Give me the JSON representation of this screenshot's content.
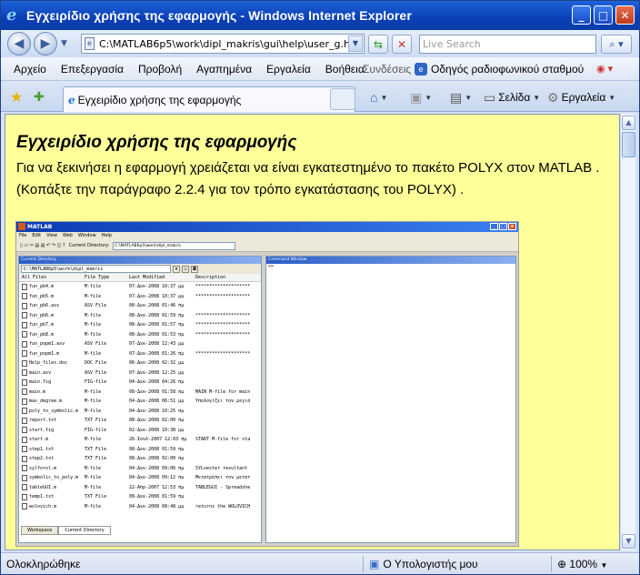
{
  "window": {
    "title": "Εγχειρίδιο χρήσης της εφαρμογής - Windows Internet Explorer",
    "minimize": "_",
    "maximize": "□",
    "close": "✕"
  },
  "address_bar": {
    "url": "C:\\MATLAB6p5\\work\\dipl_makris\\gui\\help\\user_g.htm",
    "search_placeholder": "Live Search"
  },
  "menu": {
    "items": [
      "Αρχείο",
      "Επεξεργασία",
      "Προβολή",
      "Αγαπημένα",
      "Εργαλεία",
      "Βοήθεια"
    ],
    "links_label": "Συνδέσεις",
    "radio_label": "Οδηγός ραδιοφωνικού σταθμού"
  },
  "tab": {
    "title": "Εγχειρίδιο χρήσης της εφαρμογής"
  },
  "toolbar": {
    "page_label": "Σελίδα",
    "tools_label": "Εργαλεία"
  },
  "content": {
    "heading": "Εγχειρίδιο χρήσης της εφαρμογής",
    "para1": "Για να ξεκινήσει η εφαρμογή χρειάζεται να είναι εγκατεστημένο το πακέτο POLYX στον MATLAB .",
    "para2": "(Κοπάξτε την παράγραφο 2.2.4 για τον τρόπο εγκατάστασης του POLYX) ."
  },
  "matlab_screenshot": {
    "title": "MATLAB",
    "menu": [
      "File",
      "Edit",
      "View",
      "Web",
      "Window",
      "Help"
    ],
    "current_dir_label": "Current Directory:",
    "current_dir_value": "C:\\MATLAB6p5\\work\\dipl_makris",
    "left_pane_title": "Current Directory",
    "right_pane_title": "Command Window",
    "path_value": "C:\\MATLAB6p5\\work\\dipl_makris",
    "columns": [
      "All Files",
      "File Type",
      "Last Modified",
      "Description"
    ],
    "files": [
      [
        "fun_pb4.m",
        "M-file",
        "07-Δεκ-2008 10:37 μμ",
        "********************"
      ],
      [
        "fun_pb5.m",
        "M-file",
        "07-Δεκ-2008 10:37 μμ",
        "********************"
      ],
      [
        "fun_pb6.asv",
        "ASV File",
        "08-Δεκ-2008 01:46 πμ",
        ""
      ],
      [
        "fun_pb6.m",
        "M-file",
        "08-Δεκ-2008 01:59 πμ",
        "********************"
      ],
      [
        "fun_pb7.m",
        "M-file",
        "08-Δεκ-2008 01:57 πμ",
        "********************"
      ],
      [
        "fun_pb8.m",
        "M-file",
        "08-Δεκ-2008 01:53 πμ",
        "********************"
      ],
      [
        "fun_popm1.asv",
        "ASV File",
        "07-Δεκ-2008 12:43 μμ",
        ""
      ],
      [
        "fun_popm1.m",
        "M-file",
        "07-Δεκ-2008 01:26 πμ",
        "********************"
      ],
      [
        "Help_files.doc",
        "DOC File",
        "06-Δεκ-2008 02:32 μμ",
        ""
      ],
      [
        "main.asv",
        "ASV File",
        "07-Δεκ-2008 12:25 μμ",
        ""
      ],
      [
        "main.fig",
        "FIG-file",
        "04-Δεκ-2008 04:26 πμ",
        ""
      ],
      [
        "main.m",
        "M-file",
        "08-Δεκ-2008 01:58 πμ",
        "MAIN M-file for main"
      ],
      [
        "max_degree.m",
        "M-file",
        "04-Δεκ-2008 06:51 μμ",
        "Υπολογίζει τον μεγισ"
      ],
      [
        "poly_to_symbolic.m",
        "M-file",
        "04-Δεκ-2008 10:25 πμ",
        ""
      ],
      [
        "report.txt",
        "TXT File",
        "08-Δεκ-2008 02:00 πμ",
        ""
      ],
      [
        "start.fig",
        "FIG-file",
        "02-Δεκ-2008 10:38 μμ",
        ""
      ],
      [
        "start.m",
        "M-file",
        "26-Ιουλ-2007 12:03 πμ",
        "START M-file for sta"
      ],
      [
        "step1.txt",
        "TXT File",
        "08-Δεκ-2008 01:59 πμ",
        ""
      ],
      [
        "step2.txt",
        "TXT File",
        "08-Δεκ-2008 02:00 πμ",
        ""
      ],
      [
        "sylforol.m",
        "M-file",
        "04-Δεκ-2008 09:06 πμ",
        "SYLvester resultant"
      ],
      [
        "symbolic_to_poly.m",
        "M-file",
        "04-Δεκ-2008 09:12 πμ",
        "Μετατρέπει τον μετατ"
      ],
      [
        "tableGUI.m",
        "M-file",
        "22-Απρ-2007 12:53 πμ",
        "TABLEGUI - Spreadshe"
      ],
      [
        "temp1.txt",
        "TXT File",
        "08-Δεκ-2008 01:59 πμ",
        ""
      ],
      [
        "wolovich.m",
        "M-file",
        "04-Δεκ-2008 08:48 μμ",
        "returns the WOLOVICH"
      ]
    ],
    "tabs": [
      "Workspace",
      "Current Directory"
    ],
    "prompt": ">>"
  },
  "status": {
    "left": "Ολοκληρώθηκε",
    "zone": "Ο Υπολογιστής μου",
    "zoom": "100%"
  }
}
